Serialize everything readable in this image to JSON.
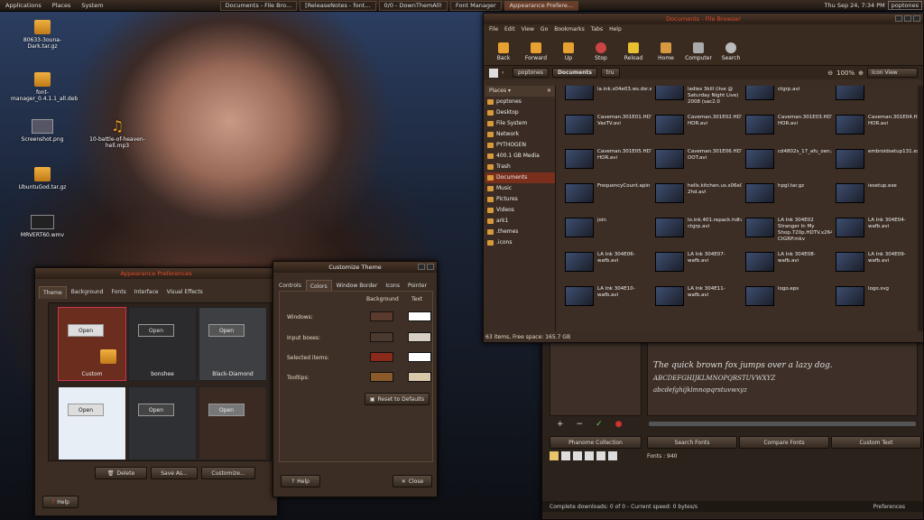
{
  "panel": {
    "menus": [
      "Applications",
      "Places",
      "System"
    ],
    "tasks": [
      "Documents - File Bro...",
      "[ReleaseNotes - font...",
      "0/0 - DownThemAll!",
      "Font Manager",
      "Appearance Prefere..."
    ],
    "clock": "Thu Sep 24,  7:34 PM",
    "user": "poptones"
  },
  "desktop": {
    "icons": [
      "80633-3ouna-Dark.tar.gz",
      "font-manager_0.4.1.1_all.deb",
      "Screenshot.png",
      "10-battle-of-heaven-hell.mp3",
      "UbuntuGod.tar.gz",
      "MRVERT60.wmv"
    ]
  },
  "appearance": {
    "title": "Appearance Preferences",
    "tabs": [
      "Theme",
      "Background",
      "Fonts",
      "Interface",
      "Visual Effects"
    ],
    "themes": [
      "Custom",
      "bonshee",
      "Black-Diamond",
      "",
      "",
      ""
    ],
    "open_label": "Open",
    "delete": "Delete",
    "save_as": "Save As...",
    "customize": "Customize...",
    "help": "Help"
  },
  "customize": {
    "title": "Customize Theme",
    "tabs": [
      "Controls",
      "Colors",
      "Window Border",
      "Icons",
      "Pointer"
    ],
    "col_bg": "Background",
    "col_text": "Text",
    "rows": [
      "Windows:",
      "Input boxes:",
      "Selected items:",
      "Tooltips:"
    ],
    "reset": "Reset to Defaults",
    "help": "Help",
    "close": "Close",
    "colors": {
      "win_bg": "#5a3a2c",
      "win_text": "#ffffff",
      "in_bg": "#4a3a30",
      "in_text": "#d8cfc4",
      "sel_bg": "#8a2a1a",
      "sel_text": "#ffffff",
      "tip_bg": "#8a5a2a",
      "tip_text": "#d8c7a8"
    }
  },
  "filemanager": {
    "title": "Documents - File Browser",
    "menus": [
      "File",
      "Edit",
      "View",
      "Go",
      "Bookmarks",
      "Tabs",
      "Help"
    ],
    "tools": [
      "Back",
      "Forward",
      "Up",
      "Stop",
      "Reload",
      "Home",
      "Computer",
      "Search"
    ],
    "crumbs": [
      "poptones",
      "Documents",
      "tru"
    ],
    "zoom": "100%",
    "view": "Icon View",
    "places_label": "Places",
    "places": [
      "poptones",
      "Desktop",
      "File System",
      "Network",
      "PYTHOGEN",
      "400.1 GB Media",
      "Trash",
      "Documents",
      "Music",
      "Pictures",
      "Videos",
      "ark1",
      ".themes",
      ".icons"
    ],
    "files": [
      "arrancar-la.ink.s04e03.ws.dsr.xvid.avi",
      "Beyonce - Single ladies 3kill (live @ Saturday Night Live) 2008 (sac2.0 1080p).mkv",
      "bill.maher.2009.09.18.hdtv.xvid-ctgrp.avi",
      "candy.html",
      "Caveman.301E01.HDTV.XViD-VasTV.avi",
      "Caveman.301E02.HDTV.XviD-HOR.avi",
      "Caveman.301E03.HDTV.XviD-HOR.avi",
      "Caveman.301E04.HDTV.XviD-HOR.avi",
      "Caveman.301E05.HDTV.XViD-HOR.avi",
      "Caveman.301E06.HDTV.XviD-DOT.avi",
      "cd4802s_17_afu_oen.pdf",
      "embroidsetup131.exe",
      "FrequencyCount.apin",
      "hells.kitchen.us.s06e06.ws.pdtv.xvid-2hd.avi",
      "hpgl.tar.gz",
      "iesetup.exe",
      "join",
      "lo.ink.401.repack.hdtv.xvid-ctgrp.avi",
      "LA Ink 304E02 Stranger In My Shop.720p.HDTV.x264-CtGRP.mkv",
      "LA Ink 304E04-wafb.avi",
      "",
      "LA Ink 304E06-wafb.avi",
      "LA Ink 304E07-wafb.avi",
      "LA Ink 304E08-wafb.avi",
      "LA Ink 304E09-wafb.avi",
      "",
      "LA Ink 304E10-wafb.avi",
      "LA Ink 304E11-wafb.avi",
      "logo.eps",
      "logo.svg"
    ],
    "status": "63 items, Free space: 165.7 GB"
  },
  "fontmgr": {
    "preview_lines": [
      "The quick brown fox jumps over a lazy dog.",
      "ABCDEFGHIJKLMNOPQRSTUVWXYZ",
      "abcdefghijklmnopqrstuvwxyz"
    ],
    "collection": "Phanome Collection",
    "search": "Search Fonts",
    "compare": "Compare Fonts",
    "custom": "Custom Text",
    "fonts": "Fonts : 940"
  },
  "downloads": {
    "status": "Complete downloads: 0 of 0 - Current speed: 0 bytes/s",
    "prefs": "Preferences"
  }
}
